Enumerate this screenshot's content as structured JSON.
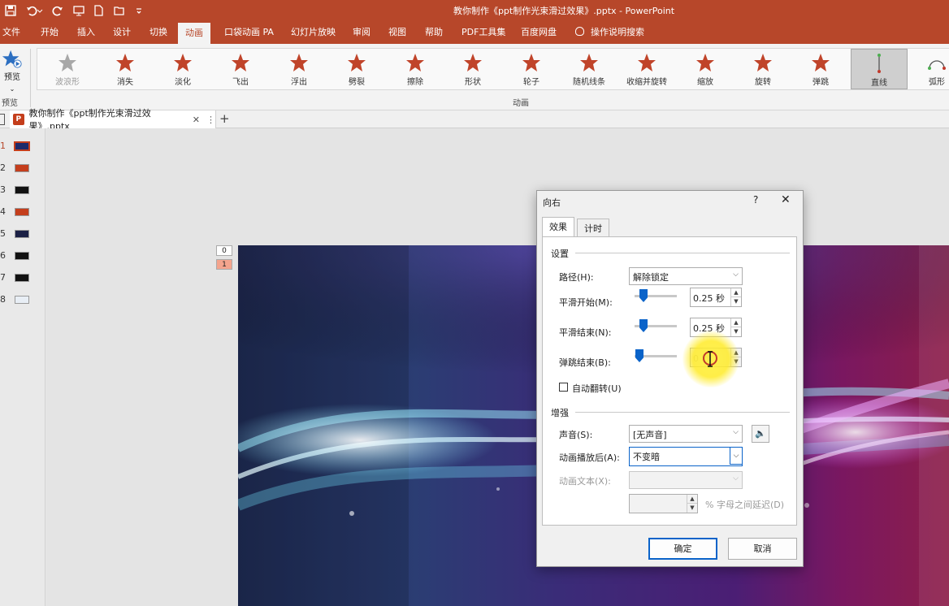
{
  "window": {
    "title": "教你制作《ppt制作光束滑过效果》.pptx  -  PowerPoint"
  },
  "menu": {
    "tabs": [
      "文件",
      "开始",
      "插入",
      "设计",
      "切换",
      "动画",
      "口袋动画 PA",
      "幻灯片放映",
      "审阅",
      "视图",
      "帮助",
      "PDF工具集",
      "百度网盘",
      "操作说明搜索"
    ],
    "active": "动画"
  },
  "ribbon": {
    "preview_label": "预览",
    "preview_group": "预览",
    "animation_group": "动画",
    "effects": [
      "波浪形",
      "消失",
      "淡化",
      "飞出",
      "浮出",
      "劈裂",
      "擦除",
      "形状",
      "轮子",
      "随机线条",
      "收缩并旋转",
      "缩放",
      "旋转",
      "弹跳",
      "直线",
      "弧形"
    ],
    "selected": "直线"
  },
  "doc_tab": {
    "label": "教你制作《ppt制作光束滑过效果》.pptx",
    "close": "✕",
    "add": "+",
    "more": "⋮"
  },
  "thumbnails": [
    "1",
    "2",
    "3",
    "4",
    "5",
    "6",
    "7",
    "8"
  ],
  "slide_badges": [
    "0",
    "1"
  ],
  "colors": {
    "accent": "#b7472a",
    "focus_blue": "#0a63c9"
  },
  "dialog": {
    "title": "向右",
    "help": "?",
    "close": "✕",
    "tabs": [
      "效果",
      "计时"
    ],
    "settings_section": "设置",
    "path_label": "路径(H):",
    "path_value": "解除锁定",
    "smooth_start_label": "平滑开始(M):",
    "smooth_start_value": "0.25 秒",
    "smooth_end_label": "平滑结束(N):",
    "smooth_end_value": "0.25 秒",
    "bounce_end_label": "弹跳结束(B):",
    "bounce_end_value": "0 秒",
    "auto_reverse_label": "自动翻转(U)",
    "enhance_section": "增强",
    "sound_label": "声音(S):",
    "sound_value": "[无声音]",
    "after_anim_label": "动画播放后(A):",
    "after_anim_value": "不变暗",
    "anim_text_label": "动画文本(X):",
    "delay_text": "% 字母之间延迟(D)",
    "ok": "确定",
    "cancel": "取消"
  }
}
